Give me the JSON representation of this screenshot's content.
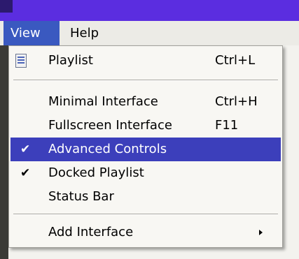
{
  "menubar": {
    "items": [
      {
        "label": "View"
      },
      {
        "label": "Help"
      }
    ]
  },
  "dropdown": {
    "items": [
      {
        "icon": "playlist-icon",
        "label": "Playlist",
        "shortcut": "Ctrl+L"
      },
      {
        "label": "Minimal Interface",
        "shortcut": "Ctrl+H"
      },
      {
        "label": "Fullscreen Interface",
        "shortcut": "F11"
      },
      {
        "checked": true,
        "check_mark": "✔",
        "label": "Advanced Controls",
        "highlighted": true
      },
      {
        "checked": true,
        "check_mark": "✔",
        "label": "Docked Playlist"
      },
      {
        "label": "Status Bar"
      },
      {
        "label": "Add Interface",
        "submenu": true
      }
    ]
  },
  "colors": {
    "highlight": "#3c3fbb",
    "menubar_active": "#3a59c0",
    "titlebar": "#5b2de0"
  }
}
